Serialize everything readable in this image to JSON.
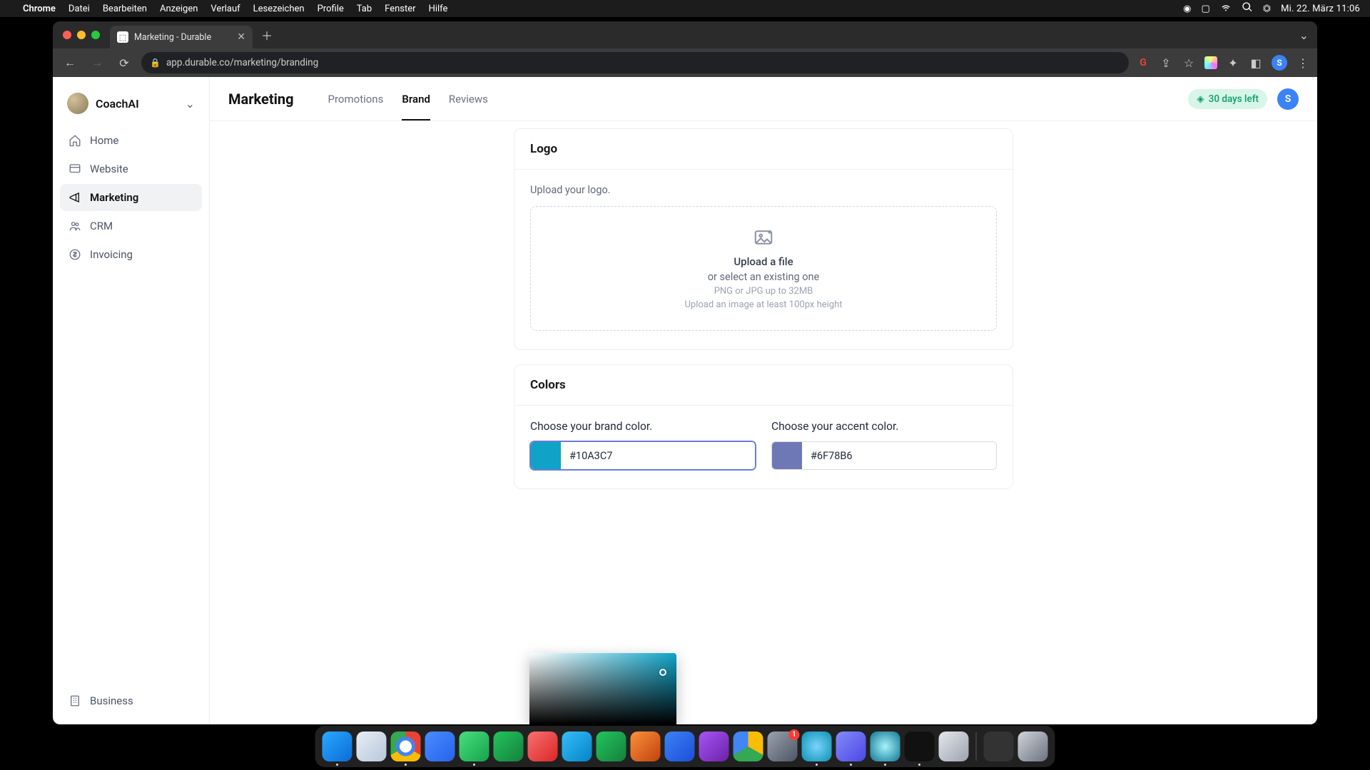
{
  "mac_menu": {
    "app": "Chrome",
    "items": [
      "Datei",
      "Bearbeiten",
      "Anzeigen",
      "Verlauf",
      "Lesezeichen",
      "Profile",
      "Tab",
      "Fenster",
      "Hilfe"
    ],
    "clock": "Mi. 22. März  11:06"
  },
  "browser": {
    "tab_title": "Marketing - Durable",
    "url": "app.durable.co/marketing/branding",
    "profile_initial": "S"
  },
  "workspace": {
    "name": "CoachAI"
  },
  "sidebar": {
    "items": [
      {
        "label": "Home"
      },
      {
        "label": "Website"
      },
      {
        "label": "Marketing"
      },
      {
        "label": "CRM"
      },
      {
        "label": "Invoicing"
      }
    ],
    "bottom": {
      "label": "Business"
    }
  },
  "page": {
    "title": "Marketing",
    "tabs": [
      {
        "label": "Promotions"
      },
      {
        "label": "Brand"
      },
      {
        "label": "Reviews"
      }
    ],
    "days_left": "30 days left",
    "profile_initial": "S"
  },
  "logo_card": {
    "heading": "Logo",
    "helper": "Upload your logo.",
    "upload_link": "Upload a file",
    "upload_sub1": "or select an existing one",
    "upload_sub2": "PNG or JPG up to 32MB",
    "upload_sub3": "Upload an image at least 100px height"
  },
  "colors_card": {
    "heading": "Colors",
    "brand_label": "Choose your brand color.",
    "accent_label": "Choose your accent color.",
    "brand_value": "#10A3C7",
    "accent_value": "#6F78B6",
    "brand_swatch": "#10A3C7",
    "accent_swatch": "#6F78B6"
  },
  "dock": {
    "apps": [
      {
        "name": "Finder",
        "bg": "linear-gradient(135deg,#2aa9ff,#0a6cd6)",
        "running": true
      },
      {
        "name": "Safari",
        "bg": "linear-gradient(135deg,#e8eef5,#b8c7da)",
        "running": false
      },
      {
        "name": "Chrome",
        "bg": "radial-gradient(circle,#fff 28%,#4285f4 29% 45%, transparent 46%), conic-gradient(#ea4335 0 120deg,#fbbc05 120deg 240deg,#34a853 240deg 360deg)",
        "running": true
      },
      {
        "name": "Zoom",
        "bg": "linear-gradient(135deg,#4a8cff,#2563eb)",
        "running": false
      },
      {
        "name": "WhatsApp",
        "bg": "linear-gradient(135deg,#4ade80,#16a34a)",
        "running": true
      },
      {
        "name": "Spotify",
        "bg": "linear-gradient(135deg,#22c55e,#15803d)",
        "running": false
      },
      {
        "name": "Todoist",
        "bg": "linear-gradient(135deg,#f87171,#dc2626)",
        "running": false
      },
      {
        "name": "Trello",
        "bg": "linear-gradient(135deg,#38bdf8,#0284c7)",
        "running": false
      },
      {
        "name": "Excel",
        "bg": "linear-gradient(135deg,#22c55e,#15803d)",
        "running": false
      },
      {
        "name": "PowerPoint",
        "bg": "linear-gradient(135deg,#fb923c,#c2410c)",
        "running": false
      },
      {
        "name": "Word",
        "bg": "linear-gradient(135deg,#3b82f6,#1d4ed8)",
        "running": false
      },
      {
        "name": "iMovie",
        "bg": "linear-gradient(135deg,#a855f7,#6b21a8)",
        "running": false
      },
      {
        "name": "Drive",
        "bg": "conic-gradient(#fbbc05 0 120deg,#34a853 120deg 240deg,#4285f4 240deg 360deg)",
        "running": false
      },
      {
        "name": "Settings",
        "bg": "linear-gradient(135deg,#9ca3af,#4b5563)",
        "running": false,
        "badge": "1"
      },
      {
        "name": "Circle",
        "bg": "radial-gradient(circle,#7dd3fc,#0891b2)",
        "running": true
      },
      {
        "name": "Discord",
        "bg": "linear-gradient(135deg,#818cf8,#4f46e5)",
        "running": true
      },
      {
        "name": "QuickTime",
        "bg": "radial-gradient(circle,#a5f3fc,#0e7490)",
        "running": true
      },
      {
        "name": "VoiceMemo",
        "bg": "#111",
        "running": true
      },
      {
        "name": "Preview",
        "bg": "linear-gradient(135deg,#e5e7eb,#9ca3af)",
        "running": false
      },
      {
        "name": "Folder",
        "bg": "#333",
        "running": false
      },
      {
        "name": "Trash",
        "bg": "linear-gradient(135deg,#d1d5db,#6b7280)",
        "running": false
      }
    ]
  }
}
